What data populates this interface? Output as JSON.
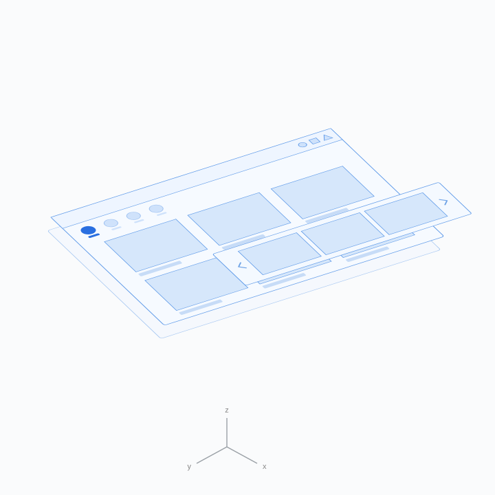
{
  "axes": {
    "x": "x",
    "y": "y",
    "z": "z"
  },
  "palette": {
    "bg": "#fafbfc",
    "panel_fill": "#f1f7ff",
    "panel_stroke": "#5d99e8",
    "tile_fill": "#d6e7fb",
    "tile_stroke": "#5d99e8",
    "accent": "#2a6fe0",
    "accent_faded": "#b7d1f5",
    "axis": "#9aa0a6"
  },
  "ui": {
    "stories": [
      {
        "active": true
      },
      {
        "active": false
      },
      {
        "active": false
      },
      {
        "active": false
      }
    ],
    "toolbar_icons": [
      "circle",
      "square",
      "triangle"
    ],
    "grid_tiles": 6,
    "carousel_cards": 3,
    "carousel_layer_offset_z": 40
  }
}
